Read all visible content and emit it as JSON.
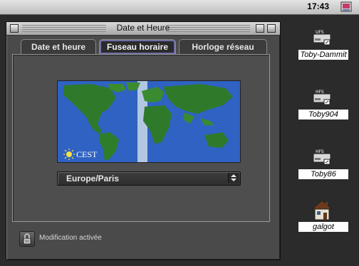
{
  "menubar": {
    "clock": "17:43",
    "app_icon": "control-panel-icon"
  },
  "window": {
    "title": "Date et Heure",
    "tabs": [
      {
        "label": "Date et heure",
        "active": false
      },
      {
        "label": "Fuseau horaire",
        "active": true
      },
      {
        "label": "Horloge réseau",
        "active": false
      }
    ],
    "map": {
      "timezone_label": "CEST",
      "sun_icon": "sun-icon"
    },
    "timezone_select": {
      "selected": "Europe/Paris"
    },
    "status": {
      "icon": "lock-icon",
      "text": "Modification activée"
    }
  },
  "desktop": {
    "icons": [
      {
        "disk_type": "UFS",
        "label": "Toby-Dammit",
        "icon": "hard-disk-icon"
      },
      {
        "disk_type": "HFS",
        "label": "Toby904",
        "icon": "hard-disk-icon"
      },
      {
        "disk_type": "HFS",
        "label": "Toby86",
        "icon": "hard-disk-icon"
      },
      {
        "disk_type": "",
        "label": "galgot",
        "icon": "house-icon"
      }
    ]
  },
  "colors": {
    "ocean": "#2f62c2",
    "land": "#2f7a2a",
    "day_band": "#c9d9e8",
    "tab_active_outline": "#6f6fa8"
  }
}
